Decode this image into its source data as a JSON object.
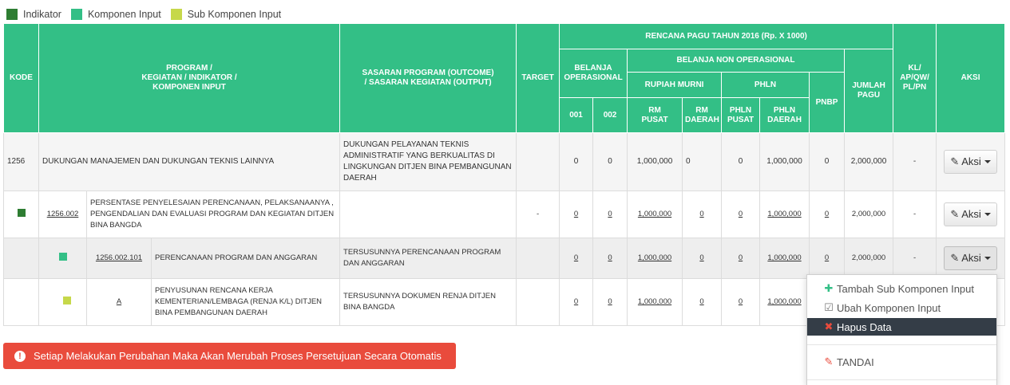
{
  "legend": [
    {
      "label": "Indikator",
      "color": "#2e7d32"
    },
    {
      "label": "Komponen Input",
      "color": "#33bf86"
    },
    {
      "label": "Sub Komponen Input",
      "color": "#c6d84a"
    }
  ],
  "headers": {
    "kode": "KODE",
    "program": "PROGRAM /\nKEGIATAN / INDIKATOR /\nKOMPONEN INPUT",
    "sasaran": "SASARAN PROGRAM (OUTCOME)\n/ SASARAN KEGIATAN (OUTPUT)",
    "target": "TARGET",
    "rencana": "RENCANA PAGU TAHUN 2016 (Rp. X 1000)",
    "belanja_operasional": "BELANJA\nOPERASIONAL",
    "belanja_non_operasional": "BELANJA NON OPERASIONAL",
    "rupiah_murni": "RUPIAH MURNI",
    "phln": "PHLN",
    "pnbp": "PNBP",
    "jumlah_pagu": "JUMLAH\nPAGU",
    "kl": "KL/\nAP/QW/\nPL/PN",
    "aksi": "AKSI",
    "col_001": "001",
    "col_002": "002",
    "rm_pusat": "RM\nPUSAT",
    "rm_daerah": "RM\nDAERAH",
    "phln_pusat": "PHLN\nPUSAT",
    "phln_daerah": "PHLN\nDAERAH"
  },
  "rows": {
    "main": {
      "kode": "1256",
      "program": "DUKUNGAN MANAJEMEN DAN DUKUNGAN TEKNIS LAINNYA",
      "sasaran": "DUKUNGAN PELAYANAN TEKNIS ADMINISTRATIF YANG BERKUALITAS DI LINGKUNGAN DITJEN BINA PEMBANGUNAN DAERAH",
      "target": "",
      "v001": "0",
      "v002": "0",
      "rm_pusat": "1,000,000",
      "rm_daerah": "0",
      "phln_pusat": "0",
      "phln_daerah": "1,000,000",
      "pnbp": "0",
      "jumlah": "2,000,000",
      "kl": "-",
      "aksi": "Aksi"
    },
    "indikator": {
      "kode": "1256.002",
      "program": "PERSENTASE PENYELESAIAN PERENCANAAN, PELAKSANAANYA , PENGENDALIAN DAN EVALUASI PROGRAM DAN KEGIATAN DITJEN BINA BANGDA",
      "sasaran": "",
      "target": "-",
      "v001": "0",
      "v002": "0",
      "rm_pusat": "1,000,000",
      "rm_daerah": "0",
      "phln_pusat": "0",
      "phln_daerah": "1,000,000",
      "pnbp": "0",
      "jumlah": "2,000,000",
      "kl": "-",
      "aksi": "Aksi"
    },
    "komponen": {
      "kode": "1256.002.101",
      "program": "PERENCANAAN PROGRAM DAN ANGGARAN",
      "sasaran": "TERSUSUNNYA PERENCANAAN PROGRAM DAN ANGGARAN",
      "target": "",
      "v001": "0",
      "v002": "0",
      "rm_pusat": "1,000,000",
      "rm_daerah": "0",
      "phln_pusat": "0",
      "phln_daerah": "1,000,000",
      "pnbp": "0",
      "jumlah": "2,000,000",
      "kl": "-",
      "aksi": "Aksi"
    },
    "sub": {
      "kode": "A",
      "program": "PENYUSUNAN RENCANA KERJA KEMENTERIAN/LEMBAGA (RENJA K/L) DITJEN BINA PEMBANGUNAN DAERAH",
      "sasaran": "TERSUSUNNYA DOKUMEN RENJA DITJEN BINA BANGDA",
      "target": "",
      "v001": "0",
      "v002": "0",
      "rm_pusat": "1,000,000",
      "rm_daerah": "0",
      "phln_pusat": "0",
      "phln_daerah": "1,000,000"
    }
  },
  "dropdown": {
    "tambah": "Tambah Sub Komponen Input",
    "ubah": "Ubah Komponen Input",
    "hapus": "Hapus Data",
    "tandai": "TANDAI"
  },
  "alert": "Setiap Melakukan Perubahan Maka Akan Merubah Proses Persetujuan Secara Otomatis",
  "colors": {
    "header": "#33bf86",
    "alert": "#e94b3c",
    "menu_highlight": "#343d47"
  }
}
